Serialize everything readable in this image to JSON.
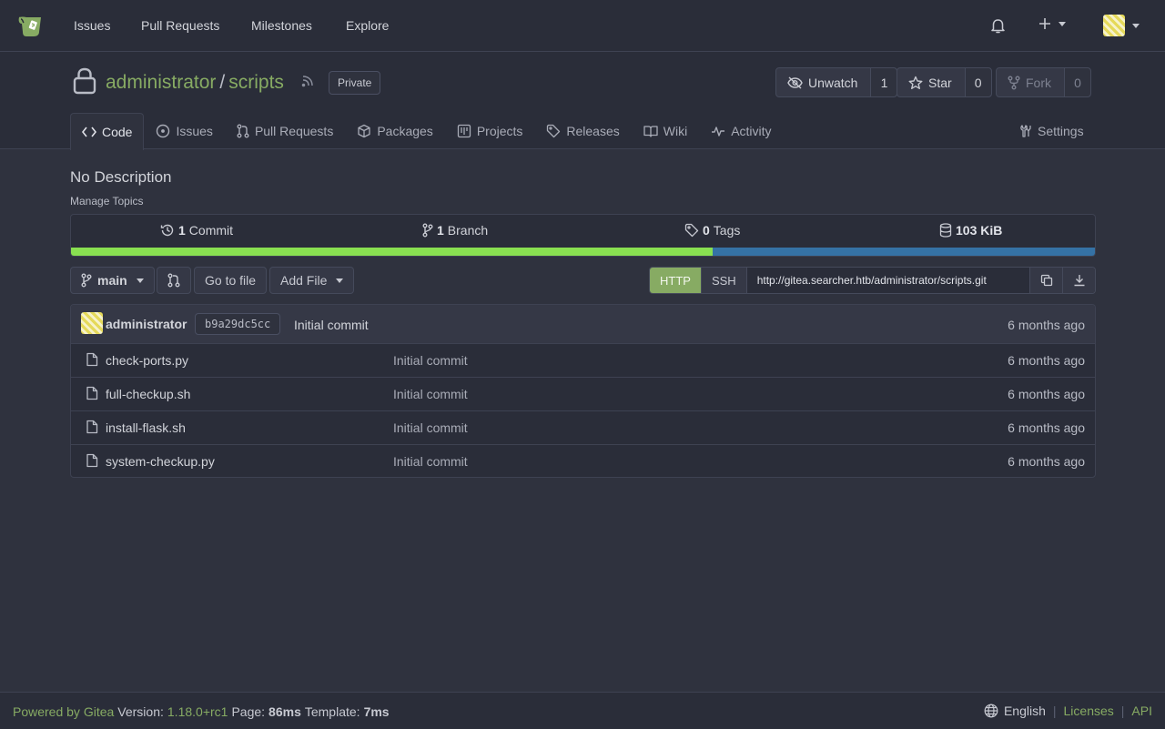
{
  "navbar": {
    "links": [
      "Issues",
      "Pull Requests",
      "Milestones",
      "Explore"
    ]
  },
  "repo": {
    "owner": "administrator",
    "name": "scripts",
    "visibility": "Private",
    "watch_label": "Unwatch",
    "watch_count": "1",
    "star_label": "Star",
    "star_count": "0",
    "fork_label": "Fork",
    "fork_count": "0",
    "tabs": [
      "Code",
      "Issues",
      "Pull Requests",
      "Packages",
      "Projects",
      "Releases",
      "Wiki",
      "Activity"
    ],
    "settings_label": "Settings",
    "description": "No Description",
    "manage_topics": "Manage Topics"
  },
  "stats": {
    "commits_num": "1",
    "commits_label": "Commit",
    "branches_num": "1",
    "branches_label": "Branch",
    "tags_num": "0",
    "tags_label": "Tags",
    "size": "103 KiB",
    "languages": [
      {
        "color": "#89e051",
        "fraction": 0.627
      },
      {
        "color": "#3572a5",
        "fraction": 0.373
      }
    ]
  },
  "toolbar": {
    "branch": "main",
    "go_to_file": "Go to file",
    "add_file": "Add File",
    "http_label": "HTTP",
    "ssh_label": "SSH",
    "clone_url": "http://gitea.searcher.htb/administrator/scripts.git"
  },
  "latest_commit": {
    "author": "administrator",
    "sha": "b9a29dc5cc",
    "message": "Initial commit",
    "time": "6 months ago"
  },
  "files": [
    {
      "name": "check-ports.py",
      "message": "Initial commit",
      "time": "6 months ago"
    },
    {
      "name": "full-checkup.sh",
      "message": "Initial commit",
      "time": "6 months ago"
    },
    {
      "name": "install-flask.sh",
      "message": "Initial commit",
      "time": "6 months ago"
    },
    {
      "name": "system-checkup.py",
      "message": "Initial commit",
      "time": "6 months ago"
    }
  ],
  "footer": {
    "powered_by": "Powered by Gitea",
    "version_label": "Version:",
    "version": "1.18.0+rc1",
    "page_label": "Page:",
    "page_time": "86ms",
    "template_label": "Template:",
    "template_time": "7ms",
    "language": "English",
    "licenses": "Licenses",
    "api": "API"
  },
  "colors": {
    "accent": "#87ab63",
    "background": "#2f323e",
    "header": "#2a2d39"
  }
}
